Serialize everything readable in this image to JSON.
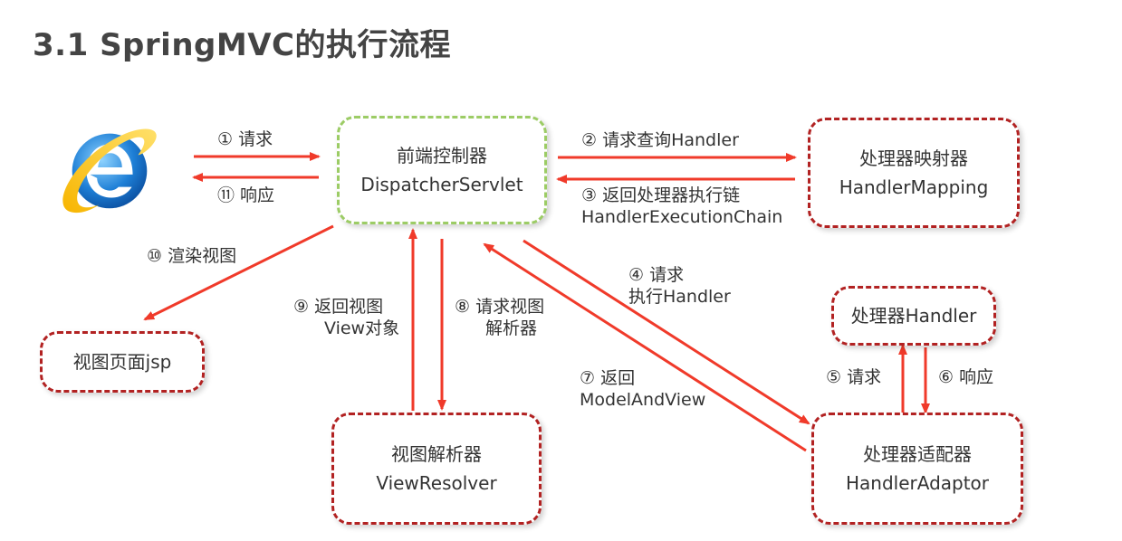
{
  "title": "3.1 SpringMVC的执行流程",
  "colors": {
    "arrow": "#f03a2a",
    "box_border": "#b22222",
    "front_border": "#9ccc65"
  },
  "browser_icon": "internet-explorer-icon",
  "boxes": {
    "front_controller": {
      "line1": "前端控制器",
      "line2": "DispatcherServlet"
    },
    "handler_mapping": {
      "line1": "处理器映射器",
      "line2": "HandlerMapping"
    },
    "handler": {
      "line1": "处理器Handler"
    },
    "handler_adaptor": {
      "line1": "处理器适配器",
      "line2": "HandlerAdaptor"
    },
    "view_resolver": {
      "line1": "视图解析器",
      "line2": "ViewResolver"
    },
    "view_page": {
      "line1": "视图页面jsp"
    }
  },
  "steps": {
    "s1": "① 请求",
    "s11": "⑪ 响应",
    "s2": "② 请求查询Handler",
    "s3_line1": "③ 返回处理器执行链",
    "s3_line2": "HandlerExecutionChain",
    "s4_line1": "④ 请求",
    "s4_line2": "执行Handler",
    "s5": "⑤ 请求",
    "s6": "⑥ 响应",
    "s7_line1": "⑦ 返回",
    "s7_line2": "ModelAndView",
    "s8_line1": "⑧ 请求视图",
    "s8_line2": "解析器",
    "s9_line1": "⑨ 返回视图",
    "s9_line2": "View对象",
    "s10": "⑩ 渲染视图"
  }
}
